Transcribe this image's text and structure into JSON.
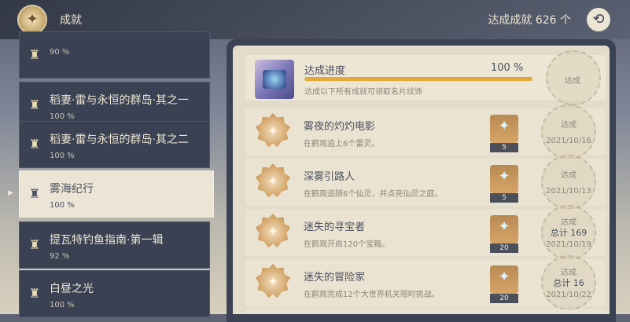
{
  "header": {
    "title": "成就",
    "total_label": "达成成就 626 个"
  },
  "sidebar": {
    "items": [
      {
        "name": "",
        "pct": "90 %"
      },
      {
        "name": "稻妻·雷与永恒的群岛·其之一",
        "pct": "100 %"
      },
      {
        "name": "稻妻·雷与永恒的群岛·其之二",
        "pct": "100 %"
      },
      {
        "name": "雾海纪行",
        "pct": "100 %"
      },
      {
        "name": "提瓦特钓鱼指南·第一辑",
        "pct": "92 %"
      },
      {
        "name": "白昼之光",
        "pct": "100 %"
      }
    ]
  },
  "progress": {
    "title": "达成进度",
    "pct_label": "100 %",
    "fill": 1.0,
    "description": "达成以下所有成就可领取名片纹饰",
    "status": "达成"
  },
  "achievements": [
    {
      "name": "雾夜的灼灼电影",
      "desc": "在鹤观追上6个雷灵。",
      "reward": "5",
      "status": "达成",
      "total": "",
      "date": "2021/10/16"
    },
    {
      "name": "深雾引路人",
      "desc": "在鹤观追随6个仙灵，并点亮仙灵之庭。",
      "reward": "5",
      "status": "达成",
      "total": "",
      "date": "2021/10/13"
    },
    {
      "name": "迷失的寻宝者",
      "desc": "在鹤观开启120个宝箱。",
      "reward": "20",
      "status": "达成",
      "total": "总计 169",
      "date": "2021/10/19"
    },
    {
      "name": "迷失的冒险家",
      "desc": "在鹤观完成12个大世界机关限时挑战。",
      "reward": "20",
      "status": "达成",
      "total": "总计 16",
      "date": "2021/10/22"
    }
  ],
  "colors": {
    "accent": "#e3a93b",
    "panel": "#e4dccb",
    "sidebar": "#3a4152"
  }
}
